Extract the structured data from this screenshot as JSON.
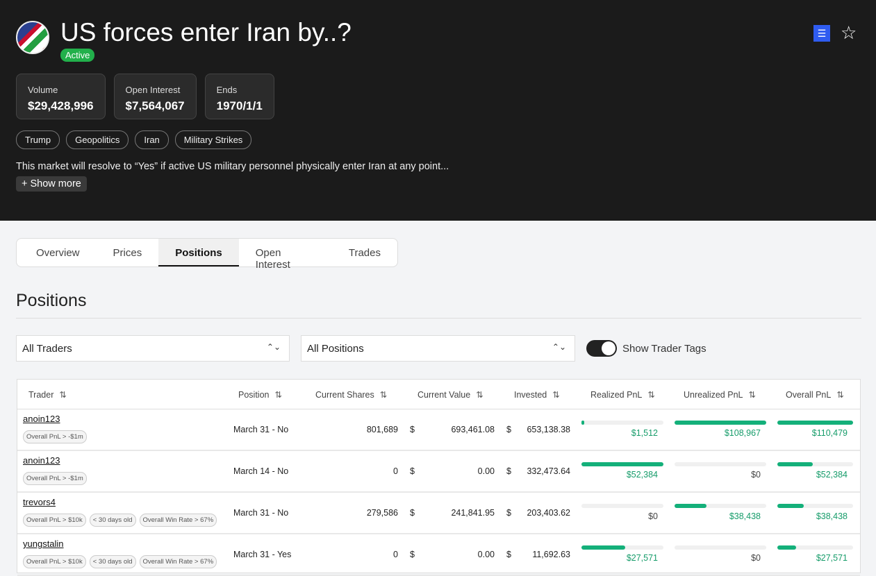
{
  "header": {
    "title": "US forces enter Iran by..?",
    "status": "Active",
    "icons": [
      "flag-avatar",
      "brand-icon",
      "star-icon"
    ],
    "stats": [
      {
        "label": "Volume",
        "value": "$29,428,996"
      },
      {
        "label": "Open Interest",
        "value": "$7,564,067"
      },
      {
        "label": "Ends",
        "value": "1970/1/1"
      }
    ],
    "tags": [
      "Trump",
      "Geopolitics",
      "Iran",
      "Military Strikes"
    ],
    "description": "This market will resolve to “Yes” if active US military personnel physically enter Iran at any point...",
    "show_more": "+ Show more"
  },
  "tabs": [
    "Overview",
    "Prices",
    "Positions",
    "Open Interest",
    "Trades"
  ],
  "active_tab": "Positions",
  "section_title": "Positions",
  "filters": {
    "traders": "All Traders",
    "positions": "All Positions",
    "toggle_label": "Show Trader Tags",
    "toggle_on": true
  },
  "columns": [
    "Trader",
    "Position",
    "Current Shares",
    "Current Value",
    "Invested",
    "Realized PnL",
    "Unrealized PnL",
    "Overall PnL"
  ],
  "accent": "#14b07a",
  "rows": [
    {
      "trader": "anoin123",
      "tags": [
        "Overall PnL > -$1m"
      ],
      "position": "March 31 - No",
      "shares": "801,689",
      "value": "693,461.08",
      "invested": "653,138.38",
      "realized": "$1,512",
      "realized_frac": 0.03,
      "unrealized": "$108,967",
      "unrealized_frac": 1,
      "overall": "$110,479",
      "overall_frac": 1
    },
    {
      "trader": "anoin123",
      "tags": [
        "Overall PnL > -$1m"
      ],
      "position": "March 14 - No",
      "shares": "0",
      "value": "0.00",
      "invested": "332,473.64",
      "realized": "$52,384",
      "realized_frac": 1,
      "unrealized": "$0",
      "unrealized_frac": 0,
      "overall": "$52,384",
      "overall_frac": 0.47
    },
    {
      "trader": "trevors4",
      "tags": [
        "Overall PnL > $10k",
        "< 30 days old",
        "Overall Win Rate > 67%"
      ],
      "position": "March 31 - No",
      "shares": "279,586",
      "value": "241,841.95",
      "invested": "203,403.62",
      "realized": "$0",
      "realized_frac": 0,
      "unrealized": "$38,438",
      "unrealized_frac": 0.35,
      "overall": "$38,438",
      "overall_frac": 0.35
    },
    {
      "trader": "yungstalin",
      "tags": [
        "Overall PnL > $10k",
        "< 30 days old",
        "Overall Win Rate > 67%"
      ],
      "position": "March 31 - Yes",
      "shares": "0",
      "value": "0.00",
      "invested": "11,692.63",
      "realized": "$27,571",
      "realized_frac": 0.53,
      "unrealized": "$0",
      "unrealized_frac": 0,
      "overall": "$27,571",
      "overall_frac": 0.25
    }
  ],
  "currency_symbol": "$"
}
